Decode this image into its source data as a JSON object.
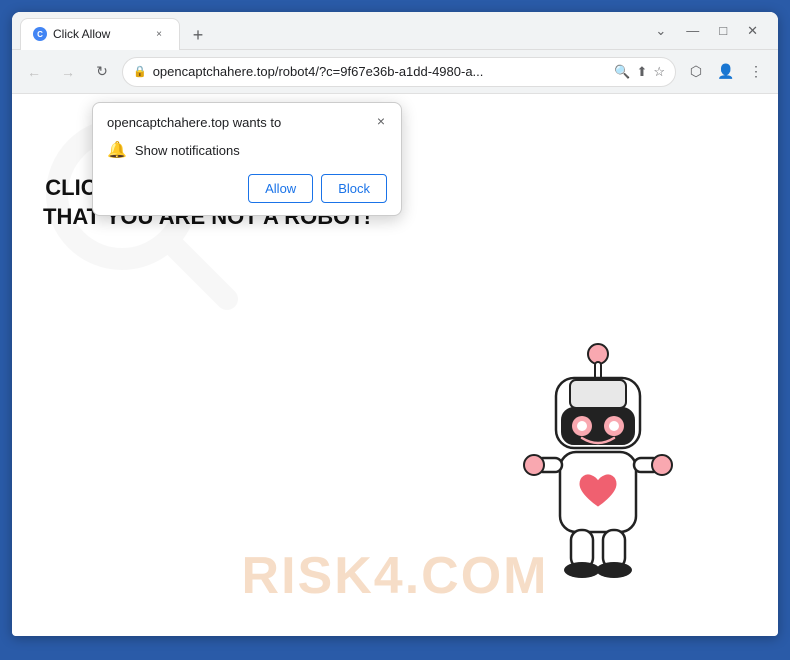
{
  "window": {
    "title": "Click Allow",
    "favicon_label": "C",
    "tab_close": "×",
    "new_tab": "+"
  },
  "controls": {
    "minimize": "—",
    "maximize": "□",
    "close": "✕",
    "chevron_down": "⌄",
    "chevron_down2": "⌄"
  },
  "toolbar": {
    "back": "←",
    "forward": "→",
    "reload": "↻",
    "address": "opencaptchahere.top/robot4/?c=9f67e36b-a1dd-4980-a...",
    "lock_icon": "🔒",
    "search_icon": "🔍",
    "share_icon": "⬆",
    "bookmark_icon": "☆",
    "extensions_icon": "⬡",
    "profile_icon": "👤",
    "menu_icon": "⋮"
  },
  "popup": {
    "title": "opencaptchahere.top wants to",
    "notification_label": "Show notifications",
    "allow_label": "Allow",
    "block_label": "Block",
    "close_label": "×"
  },
  "page": {
    "main_text": "CLICK «ALLOW» TO CONFIRM THAT YOU ARE NOT A ROBOT!",
    "watermark_text": "RISK4.COM"
  }
}
